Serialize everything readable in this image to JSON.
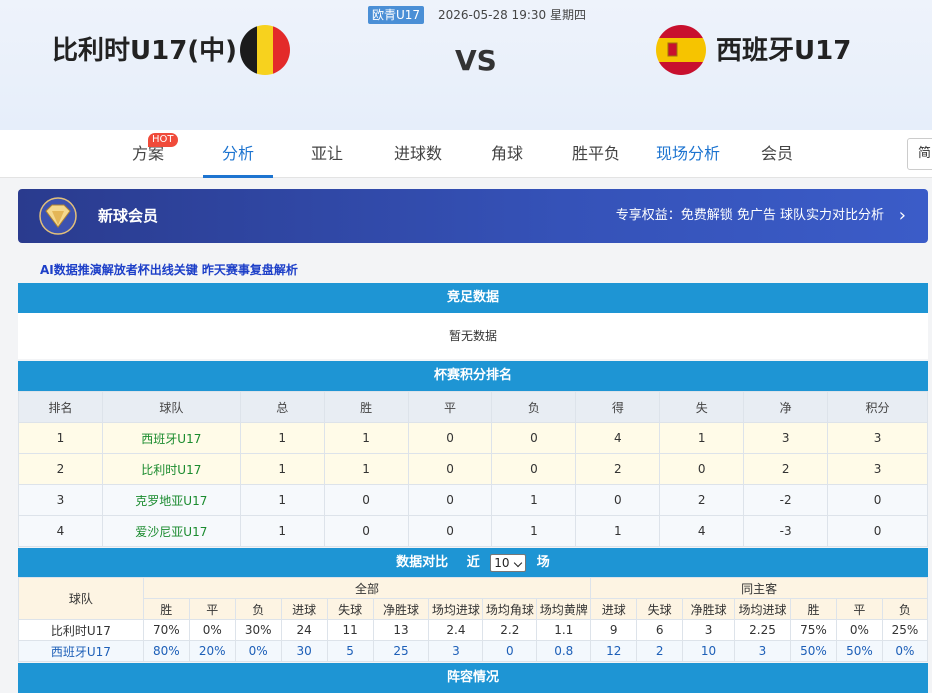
{
  "match": {
    "league": "欧青U17",
    "datetime": "2026-05-28 19:30 星期四",
    "home": "比利时U17(中)",
    "away": "西班牙U17",
    "vs": "VS"
  },
  "nav": {
    "tabs": [
      "方案",
      "分析",
      "亚让",
      "进球数",
      "角球",
      "胜平负",
      "现场分析",
      "会员"
    ],
    "hot_badge": "HOT",
    "lang_button": "简"
  },
  "vip": {
    "title": "新球会员",
    "benefits": "专享权益：免费解锁 免广告 球队实力对比分析",
    "arrow": "›"
  },
  "ai_link": "AI数据推演解放者杯出线关键 昨天赛事复盘解析",
  "sections": {
    "jingzu": "竞足数据",
    "no_data": "暂无数据",
    "cup_rank": "杯赛积分排名",
    "compare_prefix": "数据对比",
    "compare_near": "近",
    "compare_count": "10",
    "compare_suffix": "场",
    "lineup": "阵容情况"
  },
  "rank_table": {
    "headers": [
      "排名",
      "球队",
      "总",
      "胜",
      "平",
      "负",
      "得",
      "失",
      "净",
      "积分"
    ],
    "rows": [
      [
        "1",
        "西班牙U17",
        "1",
        "1",
        "0",
        "0",
        "4",
        "1",
        "3",
        "3"
      ],
      [
        "2",
        "比利时U17",
        "1",
        "1",
        "0",
        "0",
        "2",
        "0",
        "2",
        "3"
      ],
      [
        "3",
        "克罗地亚U17",
        "1",
        "0",
        "0",
        "1",
        "0",
        "2",
        "-2",
        "0"
      ],
      [
        "4",
        "爱沙尼亚U17",
        "1",
        "0",
        "0",
        "1",
        "1",
        "4",
        "-3",
        "0"
      ]
    ]
  },
  "compare_table": {
    "team_header": "球队",
    "group_all": "全部",
    "group_home": "同主客",
    "sub_all": [
      "胜",
      "平",
      "负",
      "进球",
      "失球",
      "净胜球",
      "场均进球",
      "场均角球",
      "场均黄牌"
    ],
    "sub_home": [
      "进球",
      "失球",
      "净胜球",
      "场均进球",
      "胜",
      "平",
      "负"
    ],
    "rows": [
      [
        "比利时U17",
        "70%",
        "0%",
        "30%",
        "24",
        "11",
        "13",
        "2.4",
        "2.2",
        "1.1",
        "9",
        "6",
        "3",
        "2.25",
        "75%",
        "0%",
        "25%"
      ],
      [
        "西班牙U17",
        "80%",
        "20%",
        "0%",
        "30",
        "5",
        "25",
        "3",
        "0",
        "0.8",
        "12",
        "2",
        "10",
        "3",
        "50%",
        "50%",
        "0%"
      ]
    ]
  },
  "colors": {
    "accent": "#1d74d0",
    "bar": "#1e95d4",
    "vip": "#2a3b8e",
    "team_green": "#1a8b2e"
  }
}
